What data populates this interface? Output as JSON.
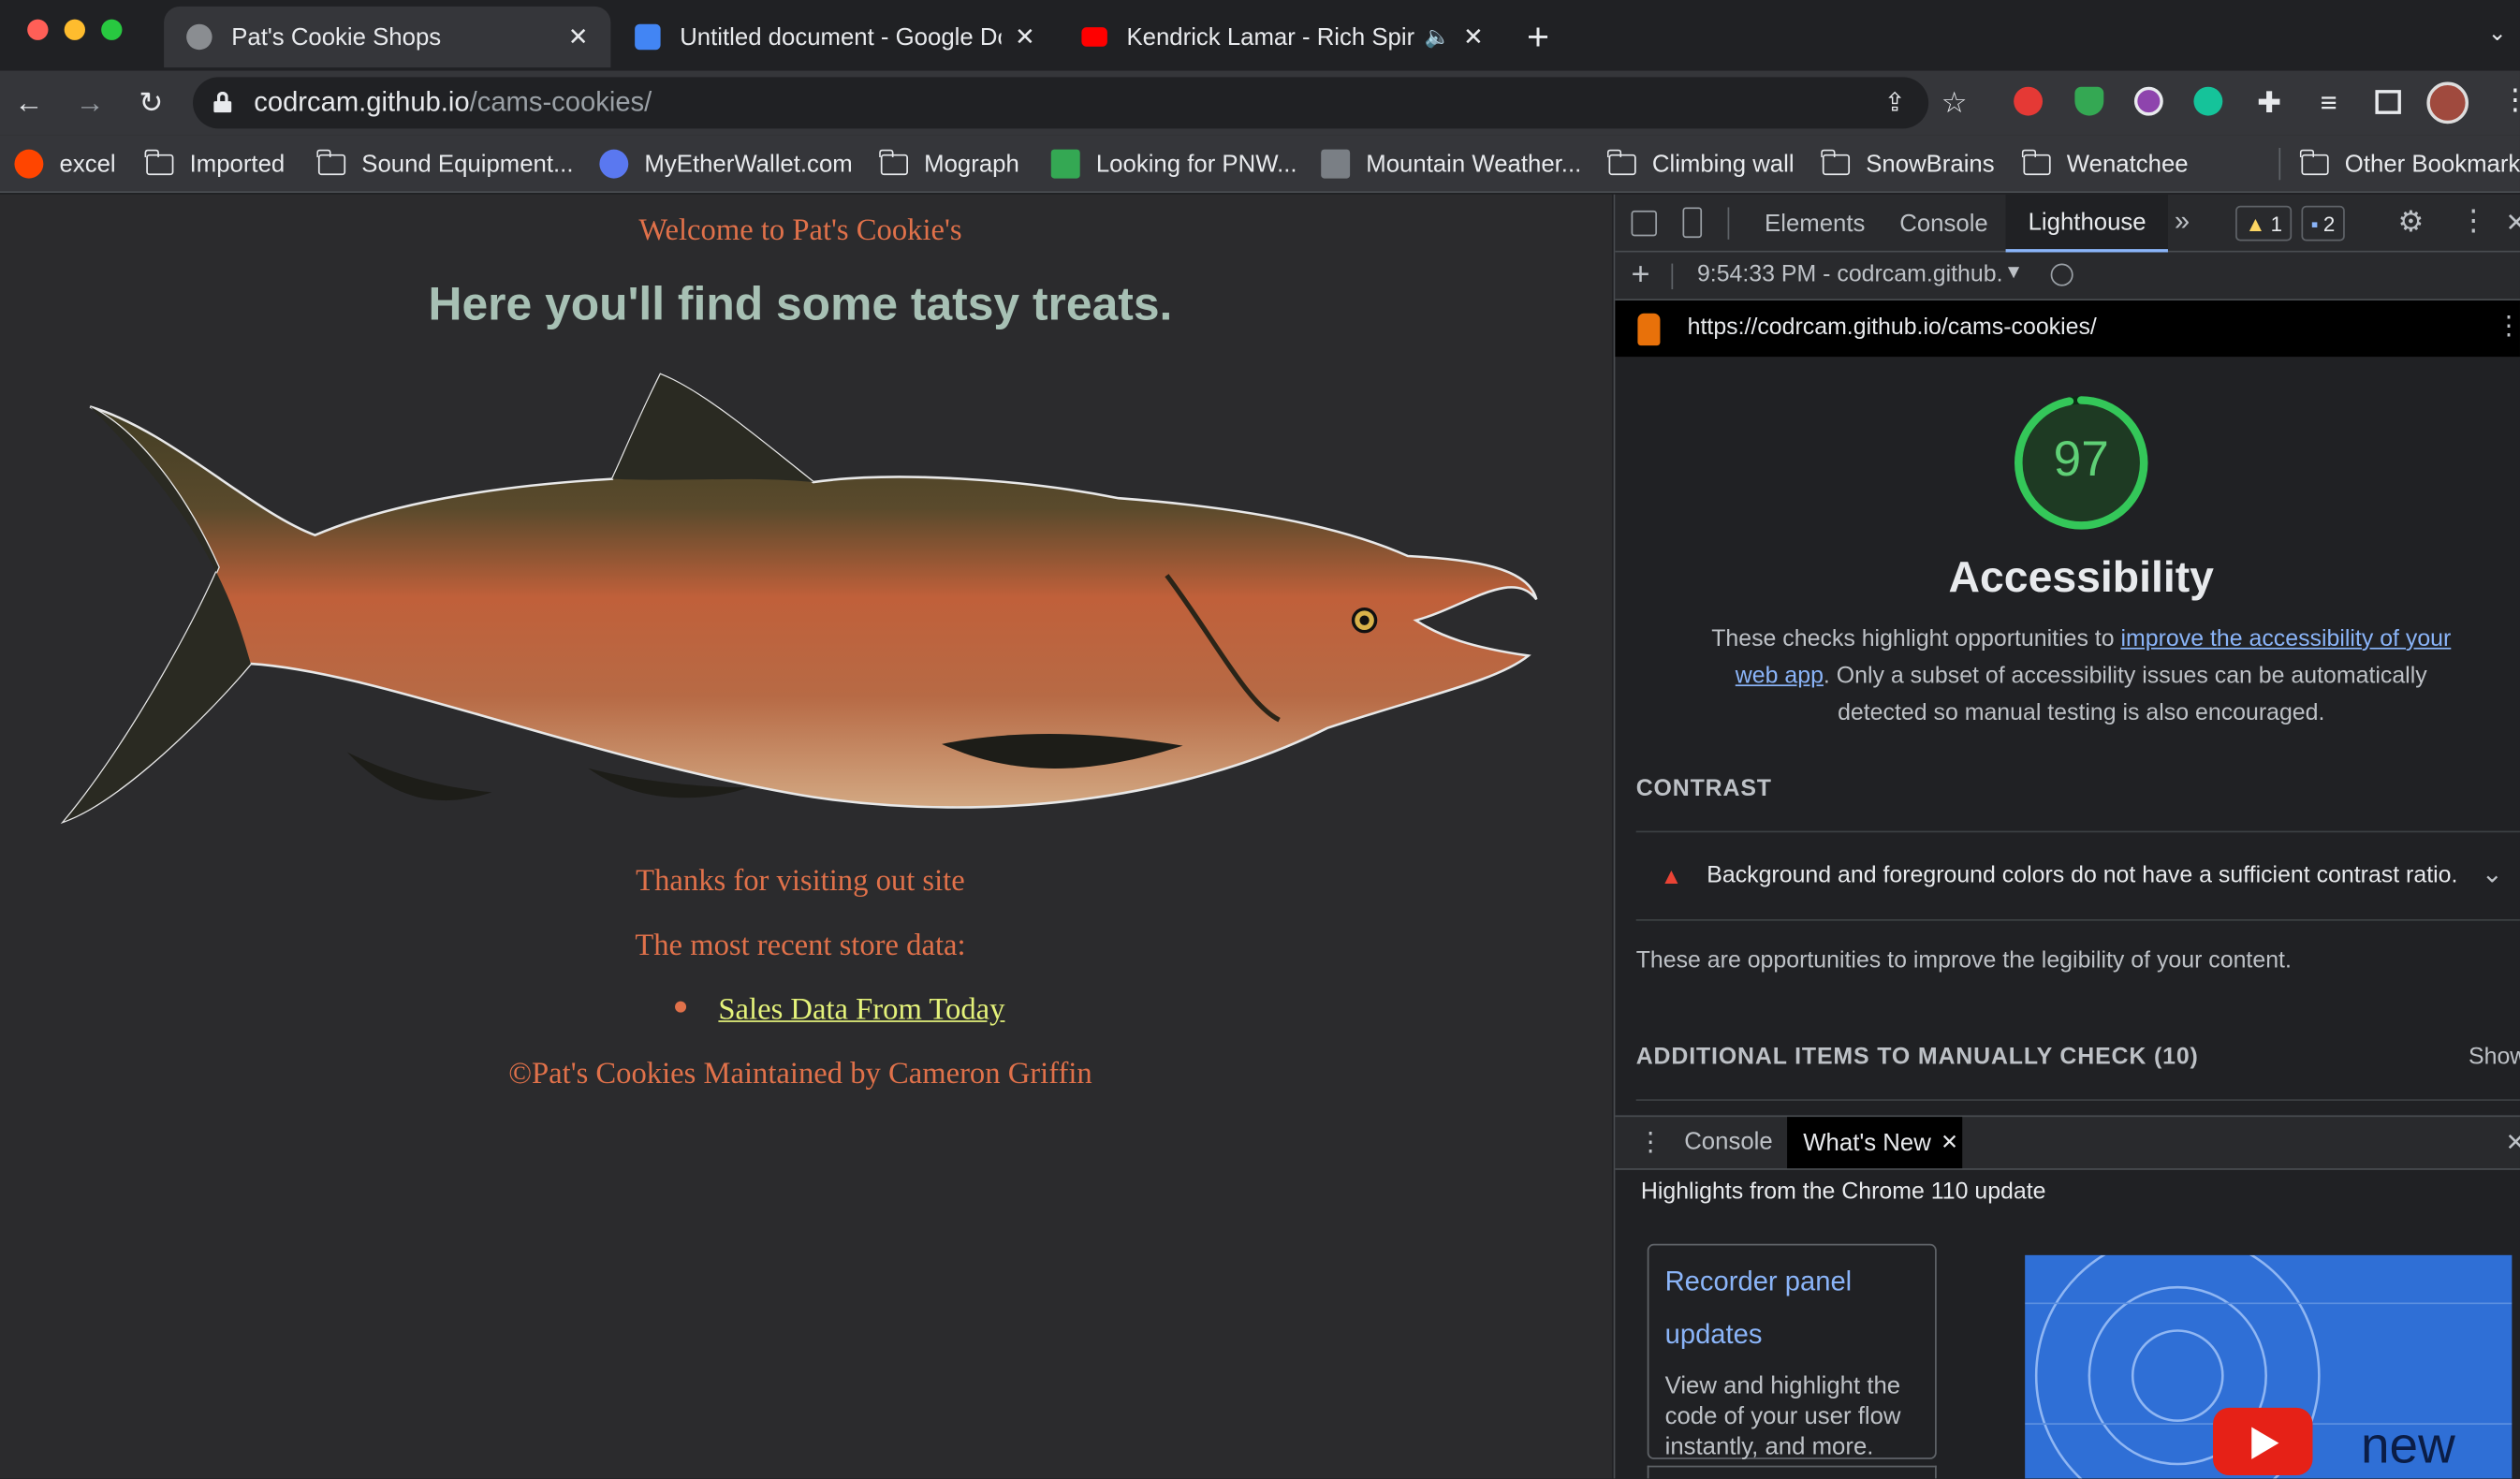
{
  "browser": {
    "tabs": [
      {
        "title": "Pat's Cookie Shops",
        "active": true
      },
      {
        "title": "Untitled document - Google Docs"
      },
      {
        "title": "Kendrick Lamar - Rich Spirit"
      }
    ],
    "address": {
      "host": "codrcam.github.io",
      "path": "/cams-cookies/"
    },
    "bookmarks": [
      "excel",
      "Imported",
      "Sound Equipment...",
      "MyEtherWallet.com",
      "Mograph",
      "Looking for PNW...",
      "Mountain Weather...",
      "Climbing wall",
      "SnowBrains",
      "Wenatchee",
      "Other Bookmarks"
    ]
  },
  "page": {
    "welcome": "Welcome to Pat's Cookie's",
    "headline": "Here you'll find some tatsy treats.",
    "thanks": "Thanks for visiting out site",
    "recent": "The most recent store data:",
    "link": "Sales Data From Today",
    "footer": "©Pat's Cookies Maintained by Cameron Griffin"
  },
  "devtools": {
    "tabs": [
      "Elements",
      "Console",
      "Lighthouse"
    ],
    "active_tab": "Lighthouse",
    "warnings": "1",
    "messages": "2",
    "report_time": "9:54:33 PM - codrcam.github.",
    "report_url": "https://codrcam.github.io/cams-cookies/",
    "score": "97",
    "score_value": 97,
    "category": "Accessibility",
    "desc_pre": "These checks highlight opportunities to ",
    "desc_link": "improve the accessibility of your web app",
    "desc_post": ". Only a subset of accessibility issues can be automatically detected so manual testing is also encouraged.",
    "section_contrast": "CONTRAST",
    "audit": "Background and foreground colors do not have a sufficient contrast ratio.",
    "opportunities": "These are opportunities to improve the legibility of your content.",
    "manual": "ADDITIONAL ITEMS TO MANUALLY CHECK (10)",
    "show": "Show",
    "drawer_tabs": [
      "Console",
      "What's New"
    ],
    "highlights": "Highlights from the Chrome 110 update",
    "card_title": "Recorder panel updates",
    "card_body": "View and highlight the code of your user flow instantly, and more.",
    "video_label": "new"
  }
}
